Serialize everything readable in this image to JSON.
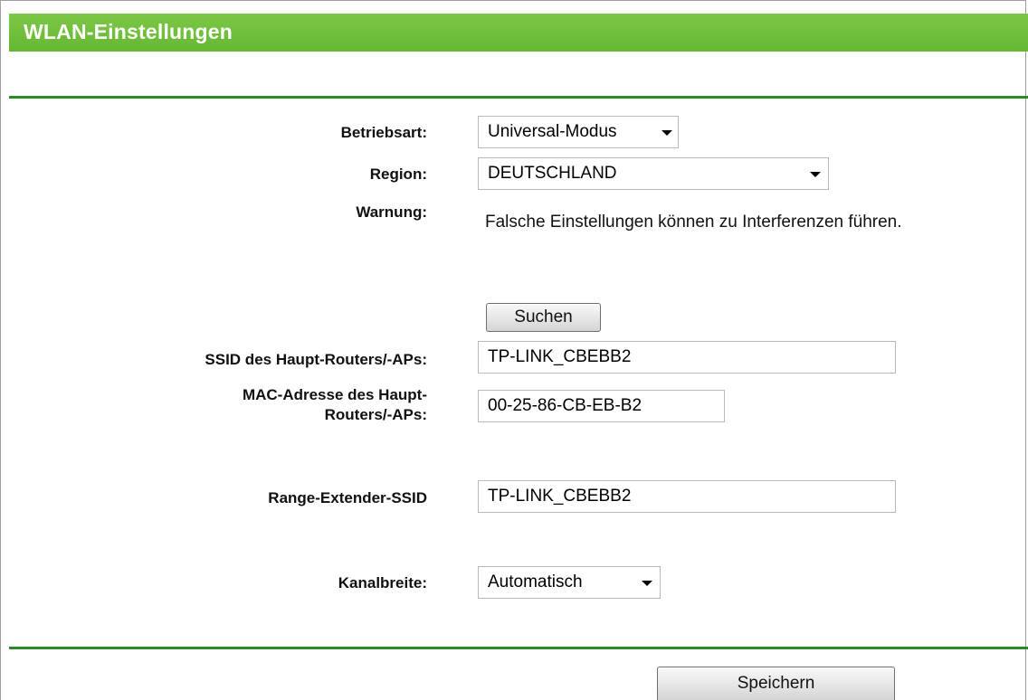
{
  "header": {
    "title": "WLAN-Einstellungen"
  },
  "form": {
    "betriebsart": {
      "label": "Betriebsart:",
      "value": "Universal-Modus"
    },
    "region": {
      "label": "Region:",
      "value": "DEUTSCHLAND"
    },
    "warnung": {
      "label": "Warnung:",
      "text": "Falsche Einstellungen können zu Interferenzen führen."
    },
    "search_button": "Suchen",
    "ssid_main": {
      "label": "SSID des Haupt-Routers/-APs:",
      "value": "TP-LINK_CBEBB2"
    },
    "mac_main": {
      "label_line1": "MAC-Adresse des Haupt-",
      "label_line2": "Routers/-APs:",
      "value": "00-25-86-CB-EB-B2"
    },
    "extender_ssid": {
      "label": "Range-Extender-SSID",
      "value": "TP-LINK_CBEBB2"
    },
    "kanalbreite": {
      "label": "Kanalbreite:",
      "value": "Automatisch"
    }
  },
  "footer": {
    "save_button": "Speichern"
  },
  "colors": {
    "header_green": "#66b732",
    "divider_green": "#2b8a28"
  },
  "icons": {
    "dropdown": "chevron-down-icon"
  }
}
